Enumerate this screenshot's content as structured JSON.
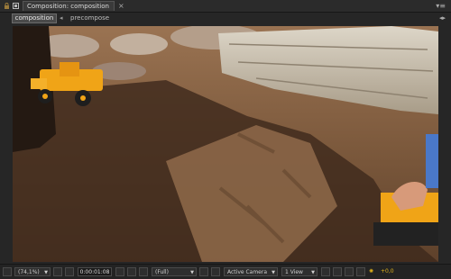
{
  "panel": {
    "tab_label": "Composition: composition",
    "close_glyph": "×",
    "menu_glyph": "▾≡"
  },
  "nav": {
    "active_crumb": "composition",
    "separator": "◂",
    "crumb": "precompose",
    "nav_arrow_glyph": "◂▸"
  },
  "viewer_bar": {
    "magnification": "(74,1%)",
    "timecode": "0:00:01:08",
    "resolution": "(Full)",
    "camera": "Active Camera",
    "views": "1 View",
    "exposure": "+0,0"
  },
  "icons": [
    "lock-icon",
    "panel-toggle-icon",
    "magnifier-dropdown-icon",
    "safe-zones-icon",
    "mask-visibility-icon",
    "snapshot-icon",
    "show-snapshot-icon",
    "color-channel-icon",
    "region-of-interest-icon",
    "transparency-grid-icon",
    "fast-preview-icon",
    "timeline-icon",
    "flowchart-icon",
    "exposure-reset-icon"
  ],
  "colors": {
    "panel_bg": "#262626",
    "accent_exposure": "#e0b21a",
    "toy_yellow": "#f0a417"
  }
}
